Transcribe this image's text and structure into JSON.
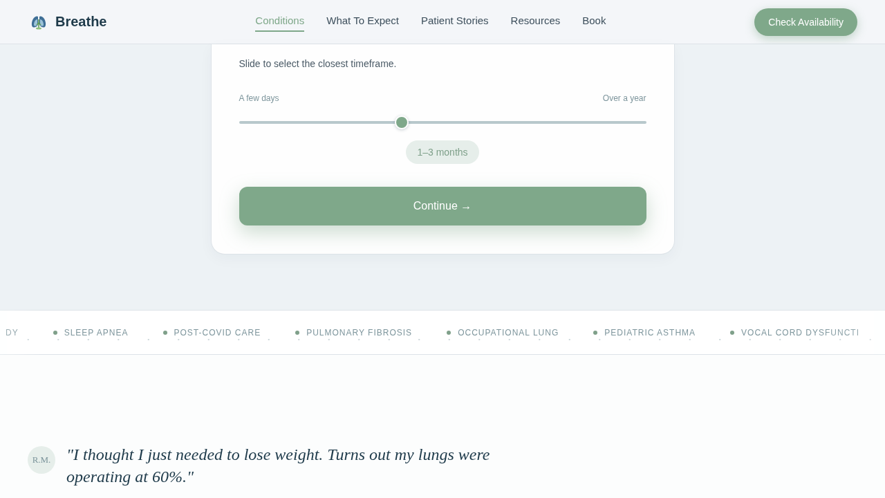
{
  "header": {
    "brand": "Breathe",
    "nav": [
      {
        "label": "Conditions",
        "selected": true
      },
      {
        "label": "What To Expect",
        "selected": false
      },
      {
        "label": "Patient Stories",
        "selected": false
      },
      {
        "label": "Resources",
        "selected": false
      },
      {
        "label": "Book",
        "selected": false
      }
    ],
    "cta": "Check Availability"
  },
  "question_card": {
    "hint": "Slide to select the closest timeframe.",
    "slider": {
      "min_label": "A few days",
      "max_label": "Over a year",
      "level": 0.4,
      "value_label": "1–3 months"
    },
    "button": "Continue →"
  },
  "conditions_ticker": [
    "DY",
    "SLEEP APNEA",
    "POST-COVID CARE",
    "PULMONARY FIBROSIS",
    "OCCUPATIONAL LUNG",
    "PEDIATRIC ASTHMA",
    "VOCAL CORD DYSFUNCTI"
  ],
  "testimonial": {
    "initials": "R.M.",
    "quote": "\"I thought I just needed to lose weight. Turns out my lungs were operating at 60%.\""
  }
}
